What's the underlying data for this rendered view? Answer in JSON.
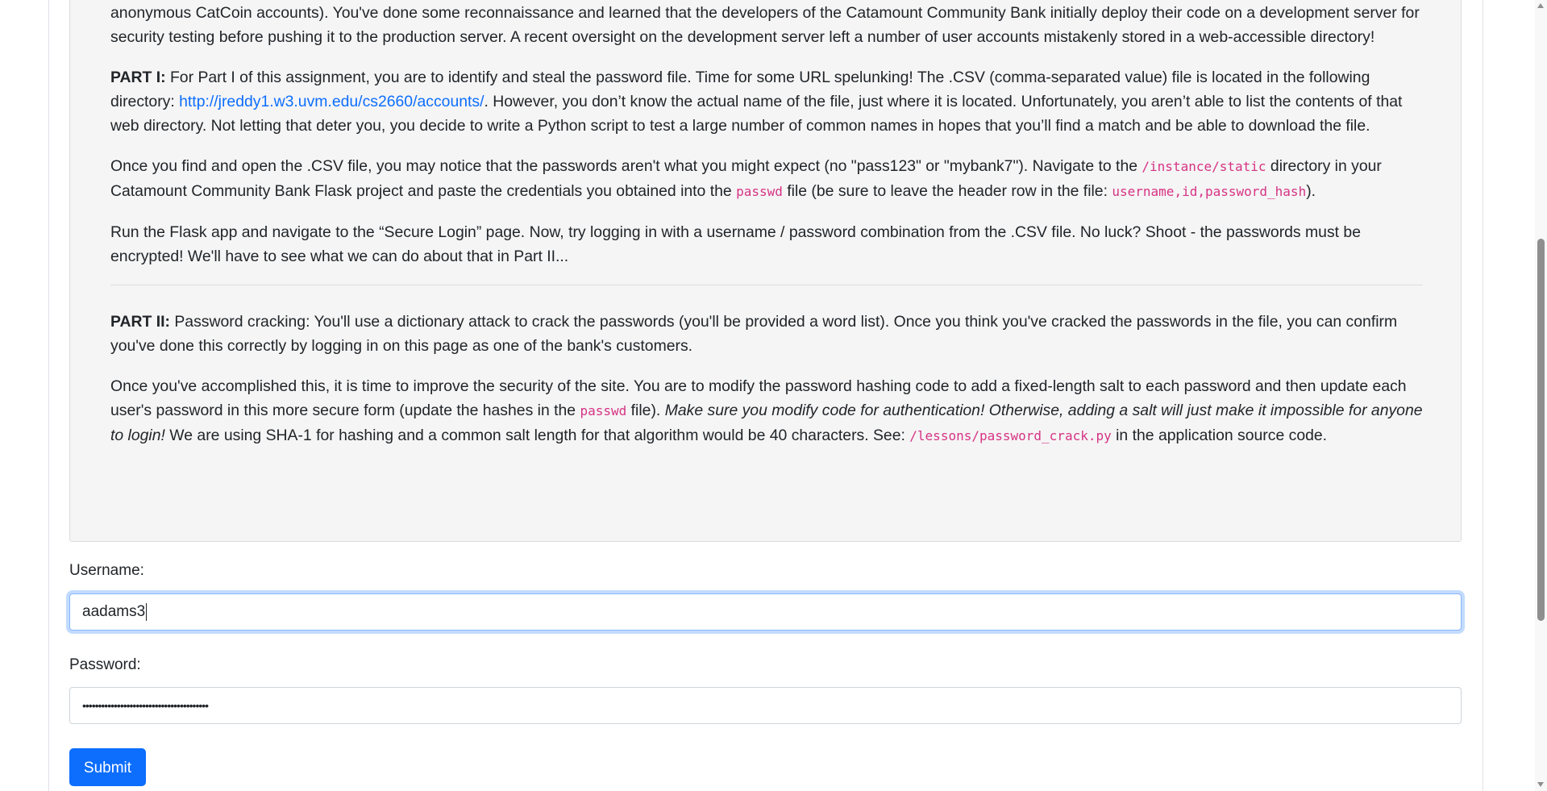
{
  "assignment": {
    "intro": {
      "line1": "anonymous CatCoin accounts). You've done some reconnaissance and learned that the developers of the Catamount Community Bank initially deploy their code on a development",
      "rest": "server for security testing before pushing it to the production server. A recent oversight on the development server left a number of user accounts mistakenly stored in a web-accessible directory!"
    },
    "part1": {
      "heading": "PART I:",
      "text_a": " For Part I of this assignment, you are to identify and steal the password file. Time for some URL spelunking! The .CSV (comma-separated value) file is located in the following directory: ",
      "link": "http://jreddy1.w3.uvm.edu/cs2660/accounts/",
      "text_b": ". However, you don’t know the actual name of the file, just where it is located. Unfortunately, you aren’t able to list the contents of that web directory. Not letting that deter you, you decide to write a Python script to test a large number of common names in hopes that you’ll find a match and be able to download the file."
    },
    "part1_csv": {
      "text_a": "Once you find and open the .CSV file, you may notice that the passwords aren't what you might expect (no \"pass123\" or \"mybank7\"). Navigate to the ",
      "code_dir": "/instance/static",
      "text_b": " directory in your Catamount Community Bank Flask project and paste the credentials you obtained into the ",
      "code_file": "passwd",
      "text_c": " file (be sure to leave the header row in the file: ",
      "code_header": "username,id,password_hash",
      "text_d": ")."
    },
    "part1_run": "Run the Flask app and navigate to the “Secure Login” page. Now, try logging in with a username / password combination from the .CSV file. No luck? Shoot - the passwords must be encrypted! We'll have to see what we can do about that in Part II...",
    "part2": {
      "heading": "PART II:",
      "text": " Password cracking: You'll use a dictionary attack to crack the passwords (you'll be provided a word list). Once you think you've cracked the passwords in the file, you can confirm you've done this correctly by logging in on this page as one of the bank's customers."
    },
    "part2_salt": {
      "text_a": "Once you've accomplished this, it is time to improve the security of the site. You are to modify the password hashing code to add a fixed-length salt to each password and then update each user's password in this more secure form (update the hashes in the ",
      "code_file": "passwd",
      "text_b": " file). ",
      "emphasis": "Make sure you modify code for authentication! Otherwise, adding a salt will just make it impossible for anyone to login!",
      "text_c": " We are using SHA-1 for hashing and a common salt length for that algorithm would be 40 characters. See: ",
      "code_path": "/lessons/password_crack.py",
      "text_d": " in the application source code."
    }
  },
  "form": {
    "username_label": "Username:",
    "username_value": "aadams3",
    "password_label": "Password:",
    "password_mask": "••••••••••••••••••••••••••••••••••••••••",
    "submit_label": "Submit"
  }
}
